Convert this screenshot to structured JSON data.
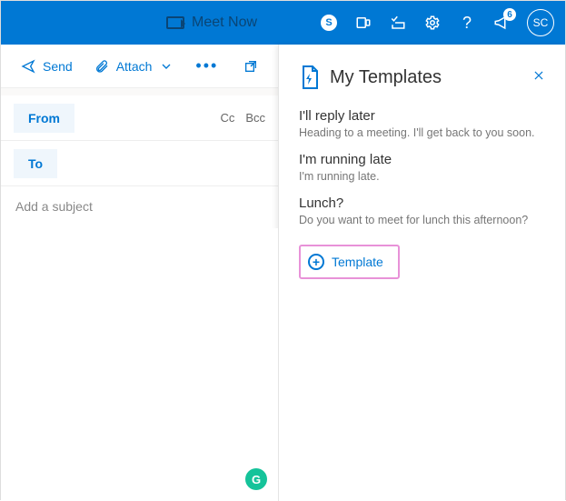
{
  "topbar": {
    "meet_label": "Meet Now",
    "skype_letter": "S",
    "notification_count": "6",
    "avatar_initials": "SC"
  },
  "toolbar": {
    "send_label": "Send",
    "attach_label": "Attach"
  },
  "fields": {
    "from_label": "From",
    "to_label": "To",
    "cc_label": "Cc",
    "bcc_label": "Bcc",
    "subject_placeholder": "Add a subject"
  },
  "panel": {
    "title": "My Templates",
    "templates": [
      {
        "title": "I'll reply later",
        "body": "Heading to a meeting. I'll get back to you soon."
      },
      {
        "title": "I'm running late",
        "body": "I'm running late."
      },
      {
        "title": "Lunch?",
        "body": "Do you want to meet for lunch this afternoon?"
      }
    ],
    "add_label": "Template"
  },
  "grammarly_letter": "G"
}
